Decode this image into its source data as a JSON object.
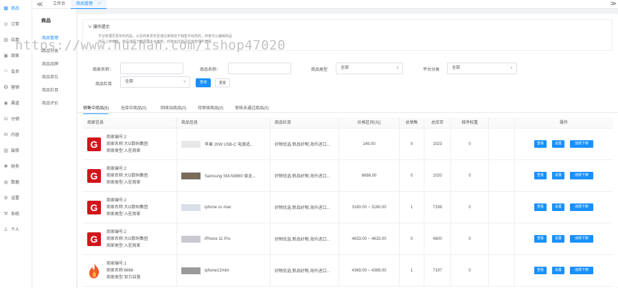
{
  "sidebar": {
    "items": [
      {
        "icon": "store-icon",
        "glyph": "▦",
        "label": "商品",
        "active": true
      },
      {
        "icon": "order-icon",
        "glyph": "◎",
        "label": "订单",
        "active": false
      },
      {
        "icon": "app-icon",
        "glyph": "▤",
        "label": "应用",
        "active": false
      },
      {
        "icon": "merchant-icon",
        "glyph": "▣",
        "label": "商家",
        "active": false
      },
      {
        "icon": "member-icon",
        "glyph": "☺",
        "label": "会员",
        "active": false
      },
      {
        "icon": "marketing-icon",
        "glyph": "✪",
        "label": "营销",
        "active": false
      },
      {
        "icon": "channel-icon",
        "glyph": "◉",
        "label": "渠道",
        "active": false
      },
      {
        "icon": "distribution-icon",
        "glyph": "⛁",
        "label": "分销",
        "active": false
      },
      {
        "icon": "content-icon",
        "glyph": "✉",
        "label": "内容",
        "active": false
      },
      {
        "icon": "decorate-icon",
        "glyph": "▥",
        "label": "装修",
        "active": false
      },
      {
        "icon": "finance-icon",
        "glyph": "✱",
        "label": "财务",
        "active": false
      },
      {
        "icon": "data-icon",
        "glyph": "◍",
        "label": "数据",
        "active": false
      },
      {
        "icon": "settings-icon",
        "glyph": "⚙",
        "label": "设置",
        "active": false
      },
      {
        "icon": "system-icon",
        "glyph": "⚒",
        "label": "系统",
        "active": false
      },
      {
        "icon": "personal-icon",
        "glyph": "♙",
        "label": "个人",
        "active": false
      }
    ]
  },
  "submenu": {
    "title": "商品",
    "items": [
      {
        "label": "商品管理",
        "active": true
      },
      {
        "label": "商品分类",
        "active": false
      },
      {
        "label": "商品品牌",
        "active": false
      },
      {
        "label": "商品单位",
        "active": false
      },
      {
        "label": "商品栏目",
        "active": false
      },
      {
        "label": "商品评价",
        "active": false
      }
    ]
  },
  "tabs": {
    "collapse": "≪",
    "expand": "≫",
    "items": [
      {
        "label": "工作台",
        "active": false,
        "close": ""
      },
      {
        "label": "商品管理",
        "active": true,
        "close": "×"
      }
    ]
  },
  "tips": {
    "title": "操作提示",
    "lines": [
      "平台管理员发布的商品，以及商家发布且通过审核处于销售中状态的，商家可以编辑商品",
      "商品上架审核、商品违规下架需要平台审核，商家可在商品栏目管理中查看"
    ]
  },
  "filters": {
    "merchant_name_label": "商家名称：",
    "merchant_name_value": "",
    "product_name_label": "商品名称：",
    "product_name_value": "",
    "product_type_label": "商品类型",
    "product_type_value": "全部",
    "platform_category_label": "平台分类",
    "platform_category_value": "全部",
    "column_label": "商品栏目",
    "column_value": "全部",
    "query_label": "查询",
    "reset_label": "重置"
  },
  "status_tabs": [
    {
      "label": "销售中商品(5)",
      "active": true
    },
    {
      "label": "仓库中商品(0)",
      "active": false
    },
    {
      "label": "回收站商品(0)",
      "active": false
    },
    {
      "label": "待审核商品(0)",
      "active": false
    },
    {
      "label": "审核未通过商品(0)",
      "active": false
    }
  ],
  "table": {
    "headers": [
      "商家信息",
      "商品信息",
      "商品栏目",
      "价格区间(元)",
      "总销售",
      "总库存",
      "排序权重",
      "操作"
    ],
    "actions": [
      "查看",
      "设置",
      "违规下架"
    ],
    "rows": [
      {
        "logo": "G",
        "merchant_no": "商家编号:2",
        "merchant_name": "商家名称:大G数码集团",
        "merchant_type": "商家类型:入驻商家",
        "product": "苹果 20W USB-C 电源适...",
        "column": "好物优选,新品好物,海外进口...",
        "price": "149.00",
        "sales": "0",
        "stock": "1023",
        "sort": "0"
      },
      {
        "logo": "G",
        "merchant_no": "商家编号:2",
        "merchant_name": "商家名称:大G数码集团",
        "merchant_type": "商家类型:入驻商家",
        "product": "Samsung SM-N9860 骁龙...",
        "column": "好物优选,新品好物,海外进口...",
        "price": "6666.00",
        "sales": "0",
        "stock": "1020",
        "sort": "0"
      },
      {
        "logo": "G",
        "merchant_no": "商家编号:2",
        "merchant_name": "商家名称:大G数码集团",
        "merchant_type": "商家类型:入驻商家",
        "product": "iphone xs max",
        "column": "好物优选,新品好物,海外进口...",
        "price": "3160.00 ~ 3160.00",
        "sales": "1",
        "stock": "7198",
        "sort": "0"
      },
      {
        "logo": "G",
        "merchant_no": "商家编号:2",
        "merchant_name": "商家名称:大G数码集团",
        "merchant_type": "商家类型:入驻商家",
        "product": "iPhone 11 Pro",
        "column": "好物优选,新品好物,海外进口...",
        "price": "4633.00 ~ 4633.00",
        "sales": "0",
        "stock": "4800",
        "sort": "0"
      },
      {
        "logo": "flame",
        "merchant_no": "商家编号:1",
        "merchant_name": "商家名称:6666",
        "merchant_type": "商家类型:官方自营",
        "product": "iphone12mini",
        "column": "好物优选,新品好物,海外进口...",
        "price": "4369.00 ~ 4369.00",
        "sales": "1",
        "stock": "7197",
        "sort": "0"
      }
    ]
  },
  "watermark": "https://www.huzhan.com/ishop47020",
  "colors": {
    "accent": "#1890ff",
    "brand_red": "#d0161a"
  }
}
